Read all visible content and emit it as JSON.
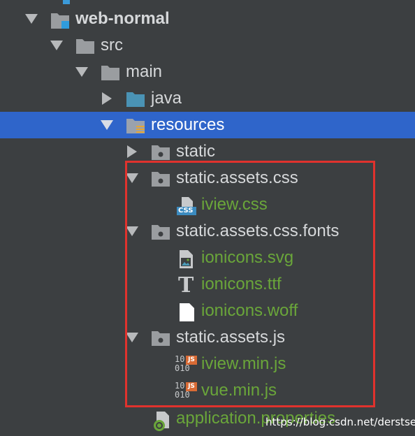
{
  "tree": {
    "project": {
      "label": "web-normal",
      "icon": "module-folder-icon"
    },
    "src": {
      "label": "src"
    },
    "main": {
      "label": "main"
    },
    "java": {
      "label": "java"
    },
    "resources": {
      "label": "resources"
    },
    "static": {
      "label": "static"
    },
    "static_assets_css": {
      "label": "static.assets.css"
    },
    "iview_css": {
      "label": "iview.css",
      "icon_text": "CSS"
    },
    "static_assets_css_fonts": {
      "label": "static.assets.css.fonts"
    },
    "ionicons_svg": {
      "label": "ionicons.svg"
    },
    "ionicons_ttf": {
      "label": "ionicons.ttf",
      "icon_text": "T"
    },
    "ionicons_woff": {
      "label": "ionicons.woff"
    },
    "static_assets_js": {
      "label": "static.assets.js"
    },
    "iview_min_js": {
      "label": "iview.min.js",
      "icon_text": "JS",
      "icon_bits": "10\n010"
    },
    "vue_min_js": {
      "label": "vue.min.js",
      "icon_text": "JS",
      "icon_bits": "10\n010"
    },
    "application_properties": {
      "label": "application.properties"
    }
  },
  "watermark": "https://blog.csdn.net/derstsea",
  "colors": {
    "background": "#3c3f41",
    "selection": "#2f65ca",
    "text": "#d6d8da",
    "file_green": "#6aa63a",
    "highlight_box": "#e0322d",
    "folder_gray": "#9a9da0",
    "folder_teal": "#4a93b5"
  }
}
